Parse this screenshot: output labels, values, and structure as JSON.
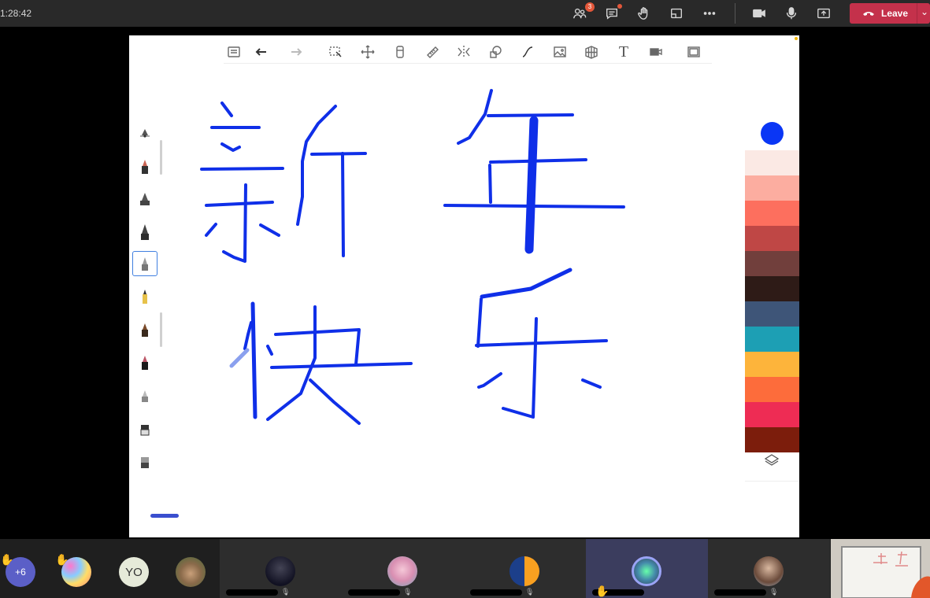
{
  "topbar": {
    "timer": "1:28:42",
    "participants_badge": "3",
    "leave_label": "Leave"
  },
  "icons": {
    "participants": "people-icon",
    "chat": "chat-icon",
    "raise_hand": "hand-icon",
    "rooms": "share-tray-icon",
    "more": "more-icon",
    "camera": "camera-icon",
    "mic": "mic-icon",
    "share": "share-icon",
    "leave": "phone-hangup-icon"
  },
  "whiteboard": {
    "toolbar": [
      "notes-icon",
      "undo-icon",
      "redo-icon",
      "select-icon",
      "move-icon",
      "eraser-icon",
      "ruler-icon",
      "flip-icon",
      "shapes-icon",
      "curve-icon",
      "image-icon",
      "grid-icon",
      "text-icon",
      "video-icon",
      "fullscreen-icon"
    ],
    "text_tool_label": "T",
    "ink_color": "#0f2fe8",
    "highlight_color": "#8aa0ee",
    "current_color": "#0a36f5",
    "palette": [
      "#fbe9e4",
      "#fcada0",
      "#fd6f5e",
      "#bf4745",
      "#713f3c",
      "#2e1b17",
      "#3e5578",
      "#1d9fb4",
      "#fdb43b",
      "#fd6c3b",
      "#ee2c54",
      "#7c1d0c"
    ],
    "pens": [
      "pencil-tool",
      "pencil-dark",
      "ink-pen",
      "fountain-pen",
      "marker-selected",
      "highlighter-yellow",
      "brush-brown",
      "brush-dark",
      "pencil-gray",
      "eraser-block",
      "eraser-block-2"
    ]
  },
  "participants": {
    "overflow_count": "+6",
    "yo_initials": "YO"
  }
}
